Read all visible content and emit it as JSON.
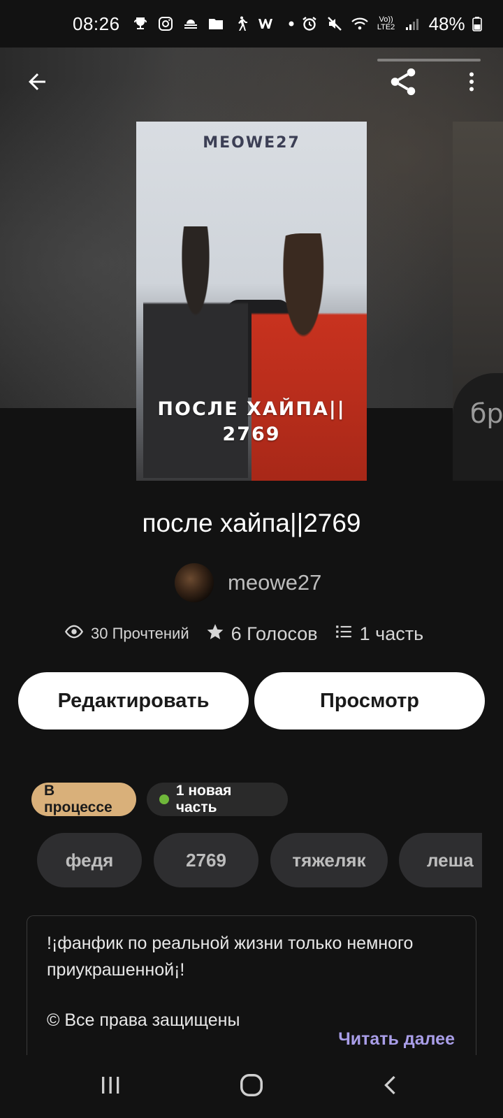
{
  "status_bar": {
    "time": "08:26",
    "network": "Vo)) LTE2",
    "battery": "48%",
    "icons": [
      "trophy-icon",
      "instagram-icon",
      "cloud-icon",
      "folder-icon",
      "walk-icon",
      "w-icon",
      "dot-icon",
      "alarm-icon",
      "mute-icon",
      "wifi-icon",
      "signal-icon",
      "battery-icon"
    ]
  },
  "header": {
    "back_icon": "arrow-left-icon",
    "share_icon": "share-icon",
    "more_icon": "more-vertical-icon"
  },
  "cover": {
    "author_text": "MEOWE27",
    "title_line1": "ПОСЛЕ ХАЙПА||",
    "title_line2": "2769",
    "next_cover_text": "бр"
  },
  "story": {
    "title": "после хайпа||2769",
    "author": "meowe27"
  },
  "stats": {
    "reads": "30 Прочтений",
    "votes": "6 Голосов",
    "parts": "1 часть"
  },
  "actions": {
    "edit_label": "Редактировать",
    "view_label": "Просмотр"
  },
  "badges": {
    "status": "В процессе",
    "new_part": "1 новая часть"
  },
  "tags": [
    "федя",
    "2769",
    "тяжеляк",
    "леша"
  ],
  "description": {
    "line1": "!¡фанфик по реальной жизни только немного",
    "line2": "приукрашенной¡!",
    "line3": "© Все права защищены",
    "read_more": "Читать далее"
  },
  "colors": {
    "background": "#121212",
    "status_badge": "#d9b07a",
    "new_dot": "#6fb73a",
    "read_more": "#a99ee8"
  }
}
